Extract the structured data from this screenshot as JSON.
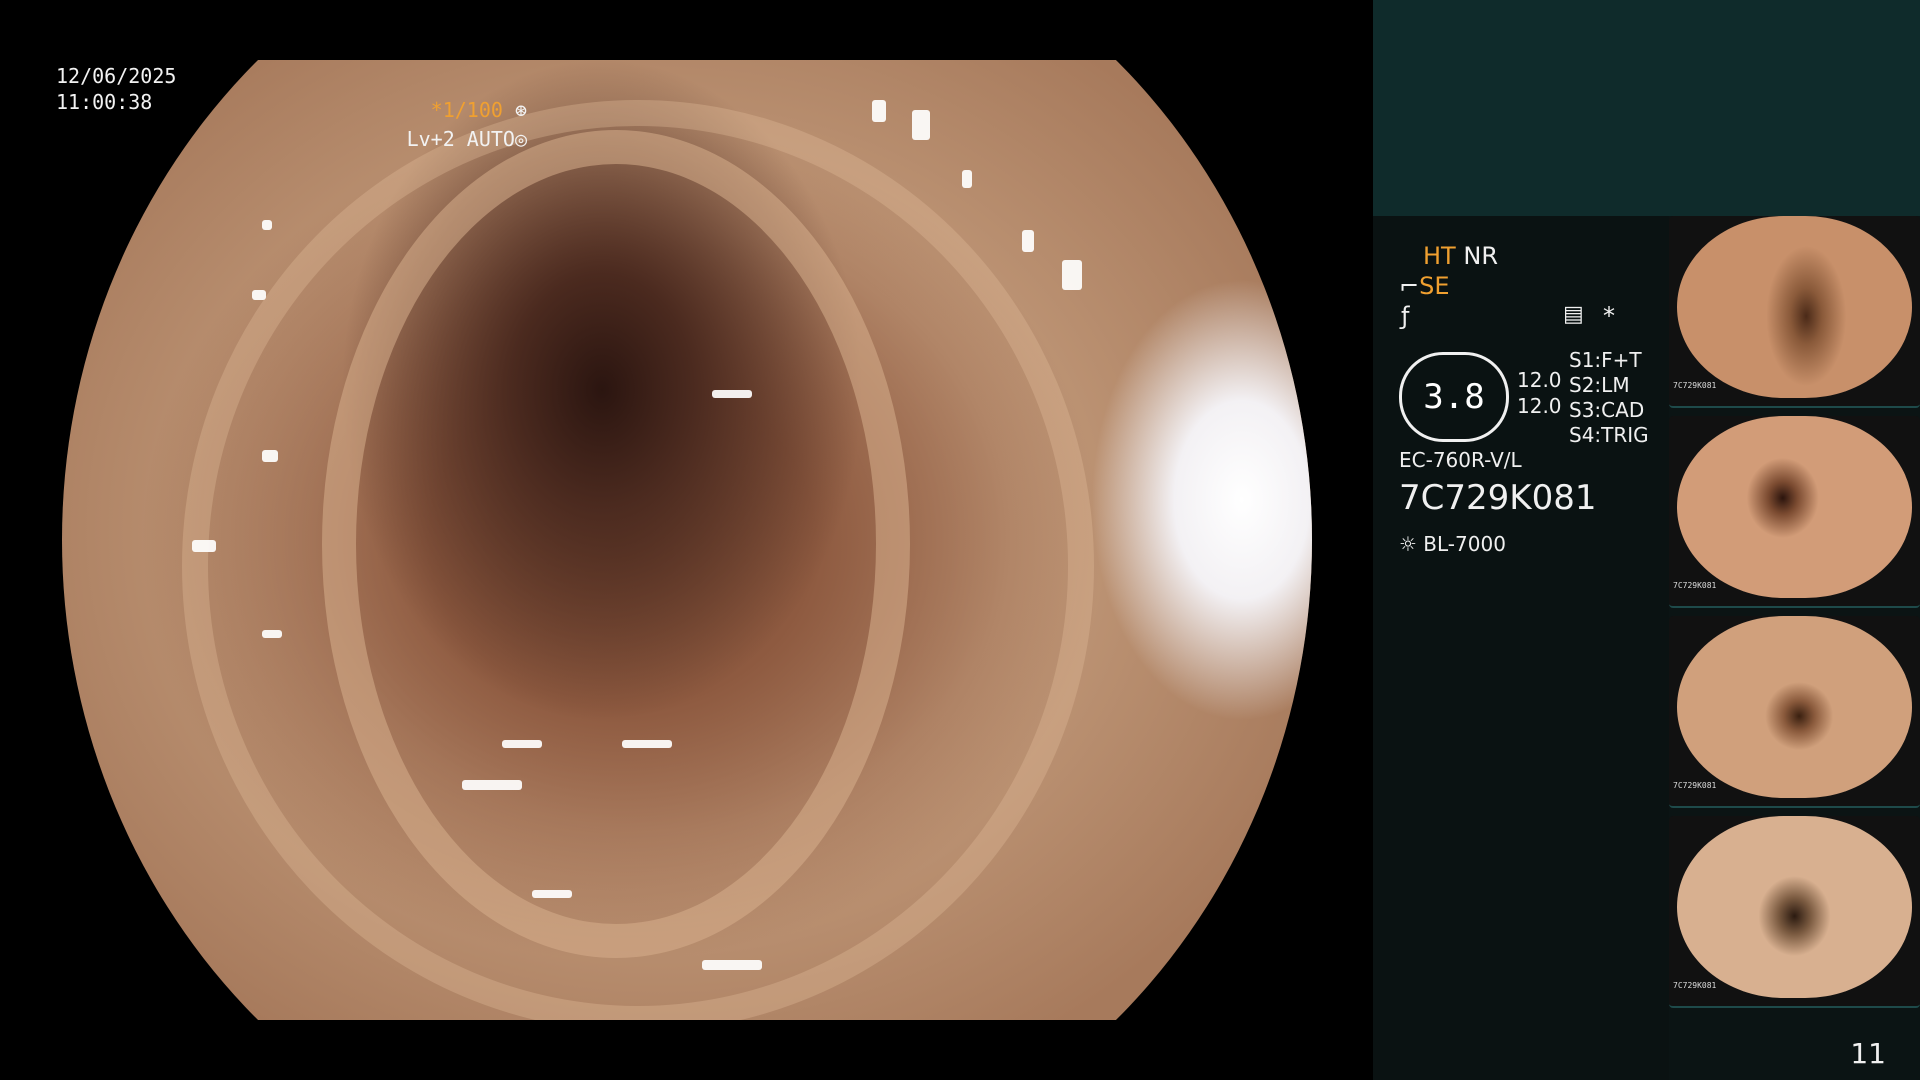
{
  "overlay": {
    "date": "12/06/2025",
    "time": "11:00:38",
    "shutter": "*1/100",
    "level": "Lv+2 AUTO"
  },
  "status": {
    "ht": "HT",
    "nr": "NR",
    "se": "SE",
    "star": "*",
    "ratio": "3.8",
    "value1": "12.0",
    "value2": "12.0",
    "s1_key": "S1:",
    "s1_val": "F+T",
    "s2_key": "S2:",
    "s2_val": "LM",
    "s3_key": "S3:",
    "s3_val": "CAD",
    "s4_key": "S4:",
    "s4_val": "TRIG",
    "scope_model": "EC-760R-V/L",
    "serial": "7C729K081",
    "light_source": "BL-7000"
  },
  "thumbnails": [
    {
      "tag": "7C729K081"
    },
    {
      "tag": "7C729K081"
    },
    {
      "tag": "7C729K081"
    },
    {
      "tag": "7C729K081"
    }
  ],
  "frame_number": "11",
  "icons": [
    "aperture-icon",
    "iris-icon",
    "probe-icon",
    "sun-icon",
    "menu-icon"
  ],
  "colors": {
    "accent": "#f0a030",
    "panel": "#0f2b2b"
  }
}
